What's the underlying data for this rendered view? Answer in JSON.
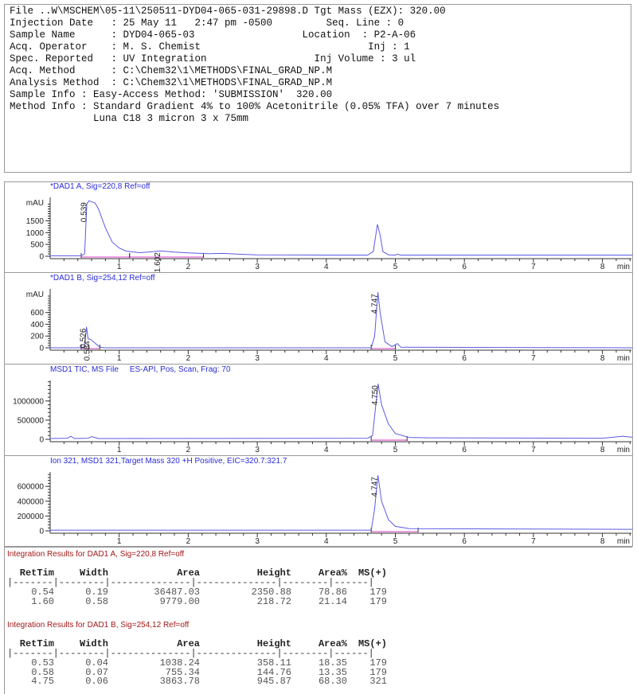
{
  "header": {
    "lines": [
      "File ..W\\MSCHEM\\05-11\\250511-DYD04-065-031-29898.D Tgt Mass (EZX): 320.00",
      "Injection Date   : 25 May 11   2:47 pm -0500         Seq. Line : 0",
      "Sample Name      : DYD04-065-03                  Location  : P2-A-06",
      "Acq. Operator    : M. S. Chemist                            Inj : 1",
      "Spec. Reported   : UV Integration                  Inj Volume : 3 ul",
      "Acq. Method      : C:\\Chem32\\1\\METHODS\\FINAL_GRAD_NP.M",
      "Analysis Method  : C:\\Chem32\\1\\METHODS\\FINAL_GRAD_NP.M",
      "Sample Info : Easy-Access Method: 'SUBMISSION'  320.00",
      "Method Info : Standard Gradient 4% to 100% Acetonitrile (0.05% TFA) over 7 minutes",
      "              Luna C18 3 micron 3 x 75mm"
    ]
  },
  "chart_data": [
    {
      "type": "line",
      "title": "*DAD1 A, Sig=220,8 Ref=off",
      "ylabel": "mAU",
      "xlabel": "min",
      "xlim": [
        0,
        8.5
      ],
      "ylim": [
        -200,
        2500
      ],
      "xticks": [
        1,
        2,
        3,
        4,
        5,
        6,
        7,
        8
      ],
      "yticks": [
        0,
        500,
        1000,
        1500
      ],
      "peak_labels": [
        {
          "x": 0.539,
          "y": 2350,
          "label": "0.539"
        },
        {
          "x": 1.602,
          "y": 230,
          "label": "1.602"
        }
      ],
      "integration_baselines": [
        [
          0.45,
          1.15
        ],
        [
          1.15,
          2.22
        ]
      ],
      "x": [
        0,
        0.45,
        0.5,
        0.53,
        0.56,
        0.65,
        0.7,
        0.8,
        0.9,
        1.0,
        1.1,
        1.3,
        1.5,
        1.6,
        1.8,
        2.0,
        2.3,
        2.5,
        2.8,
        3.0,
        4.0,
        4.6,
        4.68,
        4.74,
        4.78,
        4.82,
        4.9,
        5.0,
        5.03,
        5.07,
        8.5
      ],
      "y": [
        20,
        20,
        100,
        2200,
        2350,
        2250,
        2000,
        1200,
        600,
        350,
        220,
        150,
        200,
        230,
        180,
        140,
        110,
        120,
        80,
        60,
        50,
        50,
        200,
        1350,
        900,
        200,
        60,
        50,
        90,
        50,
        50
      ],
      "color": "#5a5ae6"
    },
    {
      "type": "line",
      "title": "*DAD1 B, Sig=254,12 Ref=off",
      "ylabel": "mAU",
      "xlabel": "min",
      "xlim": [
        0,
        8.5
      ],
      "ylim": [
        -80,
        1000
      ],
      "xticks": [
        1,
        2,
        3,
        4,
        5,
        6,
        7,
        8
      ],
      "yticks": [
        0,
        200,
        400,
        600
      ],
      "peak_labels": [
        {
          "x": 0.526,
          "y": 358,
          "label": "0.526"
        },
        {
          "x": 0.584,
          "y": 145,
          "label": "0.584"
        },
        {
          "x": 4.747,
          "y": 946,
          "label": "4.747"
        }
      ],
      "integration_baselines": [
        [
          0.45,
          0.56
        ],
        [
          0.56,
          0.72
        ],
        [
          4.65,
          5.0
        ]
      ],
      "x": [
        0,
        0.45,
        0.5,
        0.526,
        0.55,
        0.584,
        0.65,
        0.72,
        0.8,
        4.65,
        4.7,
        4.747,
        4.78,
        4.85,
        4.95,
        5.03,
        5.08,
        8.5
      ],
      "y": [
        0,
        0,
        20,
        358,
        150,
        145,
        80,
        10,
        0,
        0,
        200,
        946,
        600,
        100,
        20,
        70,
        10,
        0
      ],
      "color": "#5a5ae6"
    },
    {
      "type": "line",
      "title": "MSD1 TIC, MS File     ES-API, Pos, Scan, Frag: 70",
      "xlabel": "min",
      "xlim": [
        0,
        8.5
      ],
      "ylim": [
        -100000,
        1600000
      ],
      "xticks": [
        1,
        2,
        3,
        4,
        5,
        6,
        7,
        8
      ],
      "yticks": [
        0,
        500000,
        1000000
      ],
      "peak_labels": [
        {
          "x": 4.75,
          "y": 1450000,
          "label": "4.750"
        }
      ],
      "integration_baselines": [
        [
          4.65,
          5.17
        ]
      ],
      "x": [
        0,
        0.25,
        0.3,
        0.35,
        0.55,
        0.6,
        0.7,
        4.6,
        4.67,
        4.75,
        4.8,
        4.9,
        5.0,
        5.2,
        5.5,
        8.0,
        8.3,
        8.5
      ],
      "y": [
        20000,
        30000,
        80000,
        20000,
        30000,
        70000,
        20000,
        30000,
        100000,
        1450000,
        900000,
        400000,
        150000,
        50000,
        40000,
        30000,
        80000,
        40000
      ],
      "color": "#5a5ae6"
    },
    {
      "type": "line",
      "title": "Ion 321, MSD1 321,Target Mass 320 +H Positive, EIC=320.7:321.7",
      "xlabel": "min",
      "xlim": [
        0,
        8.5
      ],
      "ylim": [
        -50000,
        850000
      ],
      "xticks": [
        1,
        2,
        3,
        4,
        5,
        6,
        7,
        8
      ],
      "yticks": [
        0,
        200000,
        400000,
        600000
      ],
      "peak_labels": [
        {
          "x": 4.747,
          "y": 750000,
          "label": "4.747"
        }
      ],
      "integration_baselines": [
        [
          4.65,
          5.33
        ]
      ],
      "x": [
        0,
        4.65,
        4.7,
        4.747,
        4.8,
        4.9,
        5.0,
        5.2,
        8.5
      ],
      "y": [
        10000,
        10000,
        300000,
        750000,
        400000,
        150000,
        60000,
        30000,
        20000
      ],
      "color": "#5a5ae6"
    }
  ],
  "tables": [
    {
      "title": "Integration Results for DAD1 A, Sig=220,8 Ref=off",
      "headers": [
        "RetTim",
        "Width",
        "Area",
        "Height",
        "Area%",
        "MS(+)"
      ],
      "separator": "|-------|--------|--------------|--------------|--------|------|",
      "rows": [
        [
          "0.54",
          "0.19",
          "36487.03",
          "2350.88",
          "78.86",
          "179"
        ],
        [
          "1.60",
          "0.58",
          "9779.00",
          "218.72",
          "21.14",
          "179"
        ]
      ]
    },
    {
      "title": "Integration Results for DAD1 B, Sig=254,12 Ref=off",
      "headers": [
        "RetTim",
        "Width",
        "Area",
        "Height",
        "Area%",
        "MS(+)"
      ],
      "separator": "|-------|--------|--------------|--------------|--------|------|",
      "rows": [
        [
          "0.53",
          "0.04",
          "1038.24",
          "358.11",
          "18.35",
          "179"
        ],
        [
          "0.58",
          "0.07",
          "755.34",
          "144.76",
          "13.35",
          "179"
        ],
        [
          "4.75",
          "0.06",
          "3863.78",
          "945.87",
          "68.30",
          "321"
        ]
      ]
    }
  ]
}
